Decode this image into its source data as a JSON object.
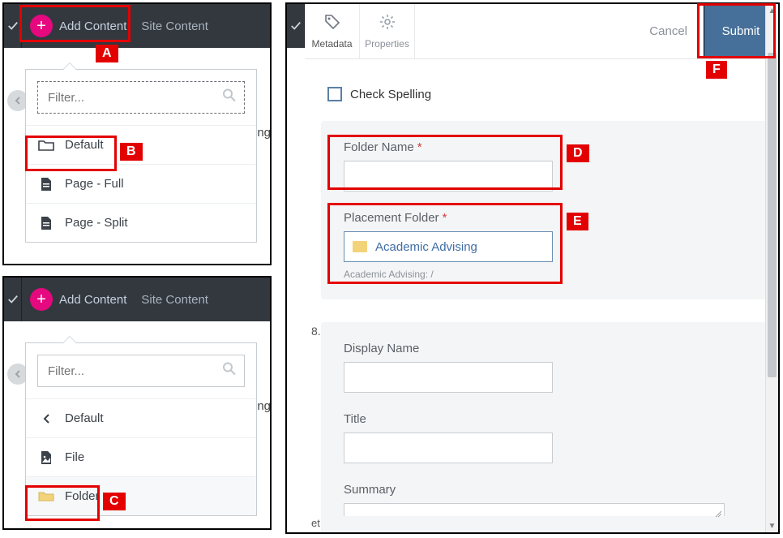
{
  "topbar": {
    "add_content": "Add Content",
    "site_content": "Site Content"
  },
  "filter": {
    "placeholder": "Filter..."
  },
  "menu1": {
    "default": "Default",
    "page_full": "Page - Full",
    "page_split": "Page - Split"
  },
  "menu2": {
    "default": "Default",
    "file": "File",
    "folder": "Folder"
  },
  "tabs": {
    "metadata": "Metadata",
    "properties": "Properties"
  },
  "actions": {
    "cancel": "Cancel",
    "submit": "Submit"
  },
  "form": {
    "check_spelling": "Check Spelling",
    "folder_name_label": "Folder Name",
    "placement_label": "Placement Folder",
    "placement_value": "Academic Advising",
    "placement_path": "Academic Advising: /",
    "display_name_label": "Display Name",
    "title_label": "Title",
    "summary_label": "Summary"
  },
  "decor": {
    "ng": "ng",
    "eight": "8.",
    "et": "et"
  },
  "annot": {
    "A": "A",
    "B": "B",
    "C": "C",
    "D": "D",
    "E": "E",
    "F": "F"
  }
}
